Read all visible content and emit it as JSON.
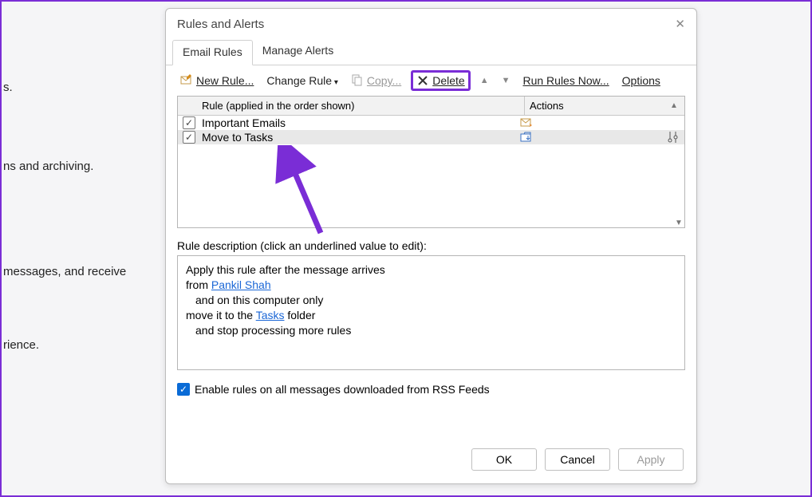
{
  "background": {
    "frag1": "s.",
    "frag2": "ns and archiving.",
    "frag3": "messages, and receive",
    "frag4": "rience."
  },
  "dialog": {
    "title": "Rules and Alerts",
    "tabs": {
      "email_rules": "Email Rules",
      "manage_alerts": "Manage Alerts"
    },
    "toolbar": {
      "new_rule": "New Rule...",
      "change_rule": "Change Rule",
      "copy": "Copy...",
      "delete": "Delete",
      "run_rules": "Run Rules Now...",
      "options": "Options"
    },
    "table": {
      "header_rule": "Rule (applied in the order shown)",
      "header_actions": "Actions",
      "rows": [
        {
          "name": "Important Emails",
          "checked": true,
          "selected": false
        },
        {
          "name": "Move to Tasks",
          "checked": true,
          "selected": true
        }
      ]
    },
    "desc_label": "Rule description (click an underlined value to edit):",
    "desc": {
      "line1": "Apply this rule after the message arrives",
      "line2_prefix": "from ",
      "line2_link": "Pankil Shah",
      "line3": "and on this computer only",
      "line4_prefix": "move it to the ",
      "line4_link": "Tasks",
      "line4_suffix": " folder",
      "line5": "and stop processing more rules"
    },
    "rss_label": "Enable rules on all messages downloaded from RSS Feeds",
    "buttons": {
      "ok": "OK",
      "cancel": "Cancel",
      "apply": "Apply"
    }
  }
}
